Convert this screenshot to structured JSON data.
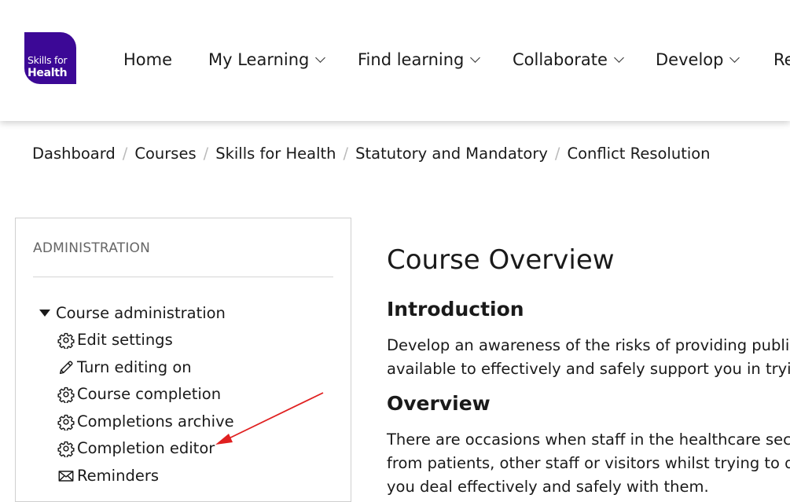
{
  "brand": {
    "logo_line1": "Skills for",
    "logo_line2": "Health",
    "color": "#3c0896"
  },
  "nav": {
    "items": [
      {
        "label": "Home",
        "has_dropdown": false
      },
      {
        "label": "My Learning",
        "has_dropdown": true
      },
      {
        "label": "Find learning",
        "has_dropdown": true
      },
      {
        "label": "Collaborate",
        "has_dropdown": true
      },
      {
        "label": "Develop",
        "has_dropdown": true
      },
      {
        "label": "Re",
        "has_dropdown": false
      }
    ]
  },
  "breadcrumb": {
    "items": [
      "Dashboard",
      "Courses",
      "Skills for Health",
      "Statutory and Mandatory",
      "Conflict Resolution"
    ],
    "separator": "/"
  },
  "administration": {
    "title": "ADMINISTRATION",
    "section_label": "Course administration",
    "items": [
      {
        "label": "Edit settings",
        "icon": "gear-icon"
      },
      {
        "label": "Turn editing on",
        "icon": "pencil-icon"
      },
      {
        "label": "Course completion",
        "icon": "gear-icon"
      },
      {
        "label": "Completions archive",
        "icon": "gear-icon"
      },
      {
        "label": "Completion editor",
        "icon": "gear-icon"
      },
      {
        "label": "Reminders",
        "icon": "envelope-icon"
      }
    ]
  },
  "main": {
    "title": "Course Overview",
    "intro_heading": "Introduction",
    "intro_text_1": "Develop an awareness of the risks of providing public h",
    "intro_text_2": "available to effectively and safely support you in trying t",
    "overview_heading": "Overview",
    "overview_text_1": "There are occasions when staff in the healthcare sector c",
    "overview_text_2": "from patients, other staff or visitors whilst trying to do t",
    "overview_text_3": "you deal effectively and safely with them."
  },
  "annotation": {
    "arrow_color": "#e02020"
  }
}
